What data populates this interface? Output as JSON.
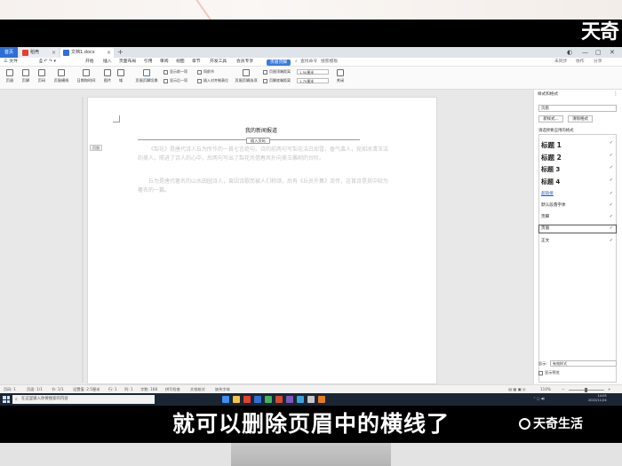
{
  "brand": {
    "logo": "天奇",
    "watermark": "天奇生活"
  },
  "caption": "就可以删除页眉中的横线了",
  "tabs": {
    "home": "首页",
    "items": [
      {
        "label": "稻壳",
        "color": "#e8402d"
      },
      {
        "label": "文档1.docx",
        "color": "#2f6fd8"
      }
    ]
  },
  "menu": {
    "items": [
      "三 文件",
      "开始",
      "插入",
      "页面布局",
      "引用",
      "审阅",
      "视图",
      "章节",
      "开发工具",
      "会员专享"
    ],
    "active": "页眉页脚",
    "search": "查找命令",
    "search2": "搜索模板",
    "right": [
      "未同步",
      "协作",
      "分享"
    ]
  },
  "ribbon": {
    "big": [
      "页眉",
      "页脚",
      "页码",
      "页眉横线",
      "日期和时间",
      "图片",
      "域",
      "页眉页脚切换",
      "页眉页脚选项",
      "关闭"
    ],
    "small": [
      "显示前一项",
      "显示后一项",
      "同前节",
      "插入对齐制表位",
      "页眉顶端距离",
      "页脚底端距离"
    ],
    "values": [
      "1.50厘米",
      "1.75厘米"
    ]
  },
  "document": {
    "header_text": "我的新闻报道",
    "header_button": "插入页码",
    "header_label": "页眉",
    "paragraphs": [
      "《梨花》是唐代诗人丘为所作的一首七言绝句。诗的前两句写梨花洁白如雪，香气袭人，宛如冰清玉洁的美人，照进了诗人的心中，后两句写出了梨花凭借春风扑向美玉雕砌的台阶。",
      "丘为是唐代著名的山水田园诗人，曾因诗歌而被人们称颂，后有《丘员外集》流传，这首诗是其中较为著名的一篇。"
    ]
  },
  "styles_pane": {
    "title": "样式和格式",
    "current": "页眉",
    "new_style": "新样式...",
    "clear": "清除格式",
    "subtitle": "请选择要应用的格式",
    "items": [
      "标题 1",
      "标题 2",
      "标题 3",
      "标题 4",
      "超链接",
      "默认段落字体",
      "页脚",
      "页眉",
      "正文"
    ],
    "selected": "页眉",
    "show_label": "显示:",
    "show_value": "有效样式",
    "preview_label": "显示预览"
  },
  "status": {
    "left": [
      "页码: 1",
      "页面: 1/1",
      "节: 1/1",
      "设置值: 2.5厘米",
      "行: 1",
      "列: 1",
      "字数: 168",
      "拼写检查",
      "文档校对",
      "缺失字体"
    ],
    "zoom": "110%"
  },
  "taskbar": {
    "search": "在这里输入你要搜索的内容",
    "time": "14:05",
    "date": "2022/11/24",
    "app_colors": [
      "#3d8ff2",
      "#f6c343",
      "#e8402d",
      "#2f6fd8",
      "#46b15f",
      "#d24d2d",
      "#7e57c2",
      "#3aa3d9",
      "#c7c7c7",
      "#e47c24"
    ]
  }
}
